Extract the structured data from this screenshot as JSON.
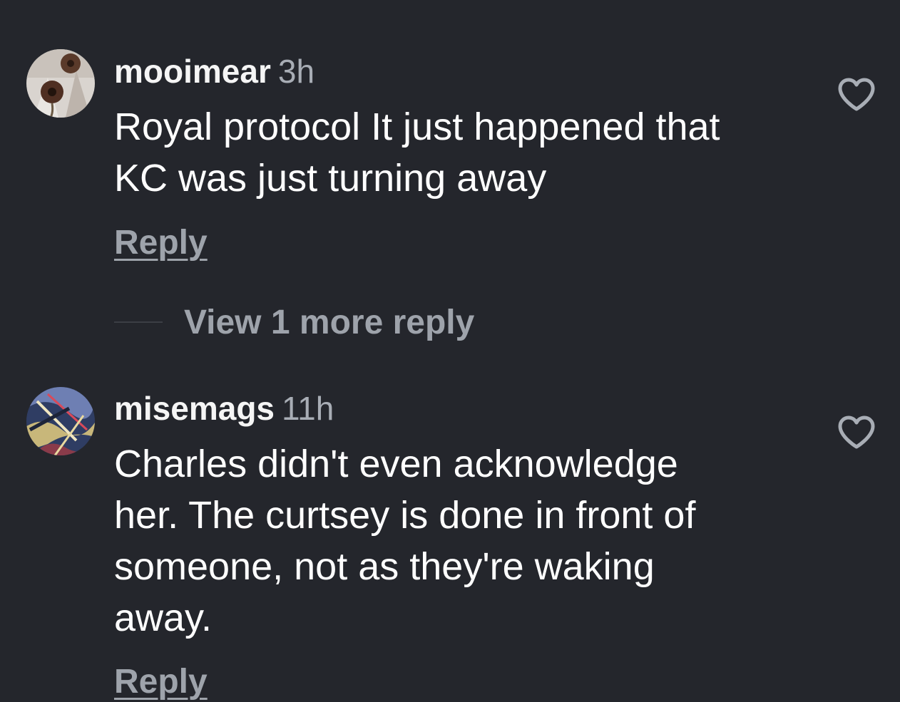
{
  "colors": {
    "background": "#24262c",
    "username": "#f5f5f5",
    "timestamp": "#a8adb5",
    "body_text": "#ffffff",
    "secondary_action": "#9ea3ab"
  },
  "comments": [
    {
      "username": "mooimear",
      "time": "3h",
      "text_line1": "Royal protocol It just happened that",
      "text_line2": "KC was just turning away",
      "reply_label": "Reply",
      "like_icon": "heart-outline-icon"
    },
    {
      "username": "misemags",
      "time": "11h",
      "text_line1": "Charles didn't even acknowledge",
      "text_line2": "her. The curtsey is done in front of",
      "text_line3": "someone, not as they're waking",
      "text_line4": "away.",
      "reply_label": "Reply",
      "like_icon": "heart-outline-icon"
    }
  ],
  "thread": {
    "view_more_label": "View 1 more reply"
  }
}
